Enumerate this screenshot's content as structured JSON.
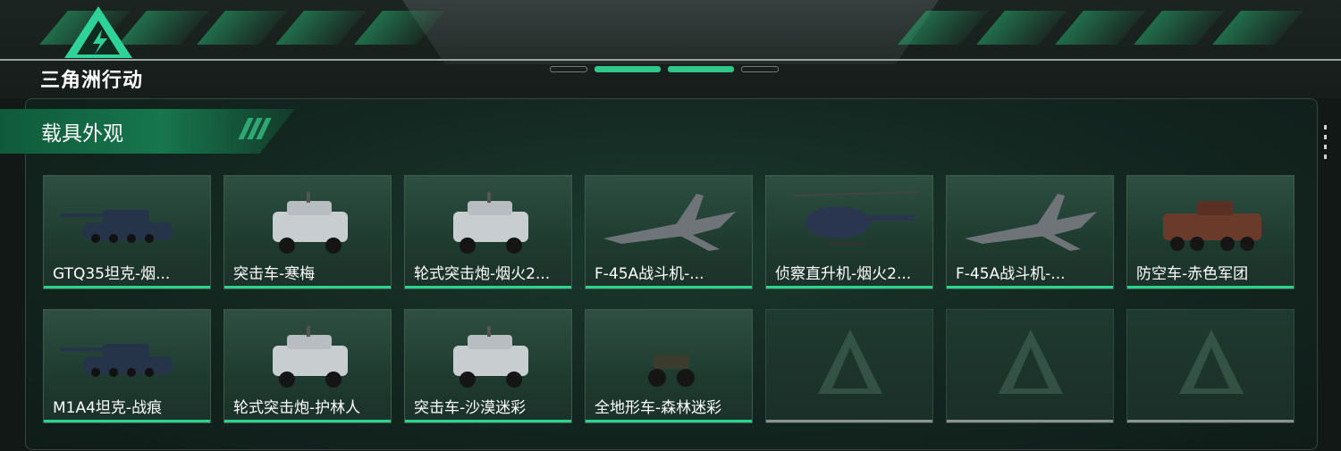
{
  "brand": {
    "name": "三角洲行动"
  },
  "section": {
    "title": "载具外观"
  },
  "colors": {
    "accent": "#2bd48c",
    "panel": "#132620",
    "header": "#17764d"
  },
  "vehicles": [
    {
      "label": "GTQ35坦克-烟...",
      "icon": "tank-icon"
    },
    {
      "label": "突击车-寒梅",
      "icon": "armored-car-icon"
    },
    {
      "label": "轮式突击炮-烟火2...",
      "icon": "armored-car-icon"
    },
    {
      "label": "F-45A战斗机-...",
      "icon": "jet-icon"
    },
    {
      "label": "侦察直升机-烟火2...",
      "icon": "helicopter-icon"
    },
    {
      "label": "F-45A战斗机-...",
      "icon": "jet-icon"
    },
    {
      "label": "防空车-赤色军团",
      "icon": "apc-icon"
    },
    {
      "label": "M1A4坦克-战痕",
      "icon": "tank-icon"
    },
    {
      "label": "轮式突击炮-护林人",
      "icon": "armored-car-icon"
    },
    {
      "label": "突击车-沙漠迷彩",
      "icon": "armored-car-icon"
    },
    {
      "label": "全地形车-森林迷彩",
      "icon": "atv-icon"
    }
  ],
  "empty_slots": 3
}
